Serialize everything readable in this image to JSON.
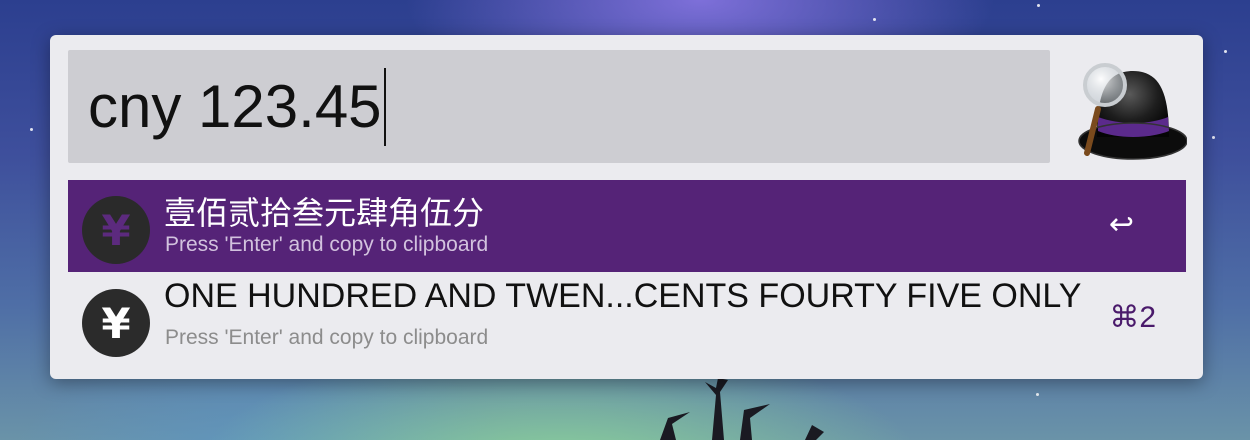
{
  "search": {
    "query": "cny 123.45"
  },
  "app": {
    "icon": "alfred-hat-icon"
  },
  "results": [
    {
      "icon": "yen-icon",
      "icon_glyph": "¥",
      "title": "壹佰贰拾叁元肆角伍分",
      "subtitle": "Press 'Enter' and copy to clipboard",
      "shortcut": "↩",
      "selected": true
    },
    {
      "icon": "yen-icon",
      "icon_glyph": "¥",
      "title": "ONE HUNDRED AND TWEN...CENTS FOURTY FIVE ONLY",
      "subtitle": "Press 'Enter' and copy to clipboard",
      "shortcut": "⌘2",
      "selected": false
    }
  ],
  "colors": {
    "selection": "#552377",
    "panel": "#ebebef",
    "search_field": "#cdcdd2"
  }
}
